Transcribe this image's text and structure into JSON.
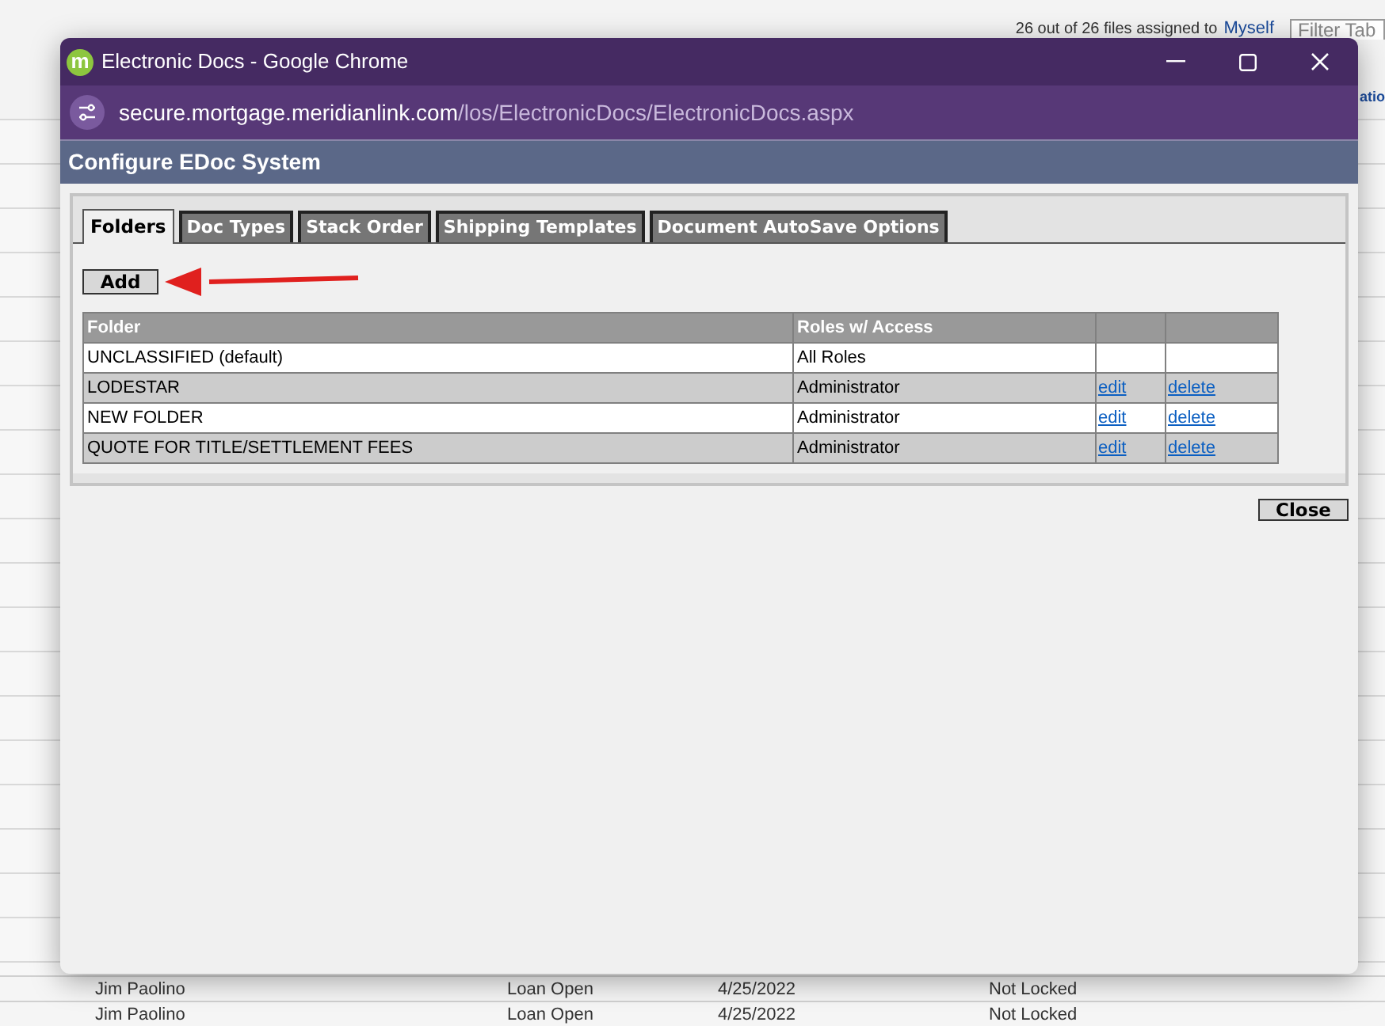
{
  "background_page": {
    "assigned_text": "26 out of 26 files assigned to",
    "assigned_link": "Myself",
    "filter": {
      "placeholder": "Filter Tab"
    },
    "cut_heading": "atio",
    "rows": [
      {
        "name": "Jim Paolino",
        "status": "Loan Open",
        "date": "4/25/2022",
        "lock": "Not Locked"
      },
      {
        "name": "Jim Paolino",
        "status": "Loan Open",
        "date": "4/25/2022",
        "lock": "Not Locked"
      }
    ]
  },
  "window": {
    "logo": "m",
    "title": "Electronic Docs - Google Chrome",
    "url_host": "secure.mortgage.meridianlink.com",
    "url_path": "/los/ElectronicDocs/ElectronicDocs.aspx"
  },
  "page": {
    "title": "Configure EDoc System",
    "tabs": [
      {
        "label": "Folders",
        "selected": true
      },
      {
        "label": "Doc Types",
        "selected": false
      },
      {
        "label": "Stack Order",
        "selected": false
      },
      {
        "label": "Shipping Templates",
        "selected": false
      },
      {
        "label": "Document AutoSave Options",
        "selected": false
      }
    ],
    "add_button": "Add",
    "table": {
      "columns": [
        "Folder",
        "Roles w/ Access"
      ],
      "rows": [
        {
          "folder": "UNCLASSIFIED (default)",
          "roles": "All Roles"
        },
        {
          "folder": "LODESTAR",
          "roles": "Administrator",
          "edit": "edit",
          "delete": "delete"
        },
        {
          "folder": "NEW FOLDER",
          "roles": "Administrator",
          "edit": "edit",
          "delete": "delete"
        },
        {
          "folder": "QUOTE FOR TITLE/SETTLEMENT FEES",
          "roles": "Administrator",
          "edit": "edit",
          "delete": "delete"
        }
      ]
    },
    "close_button": "Close"
  }
}
